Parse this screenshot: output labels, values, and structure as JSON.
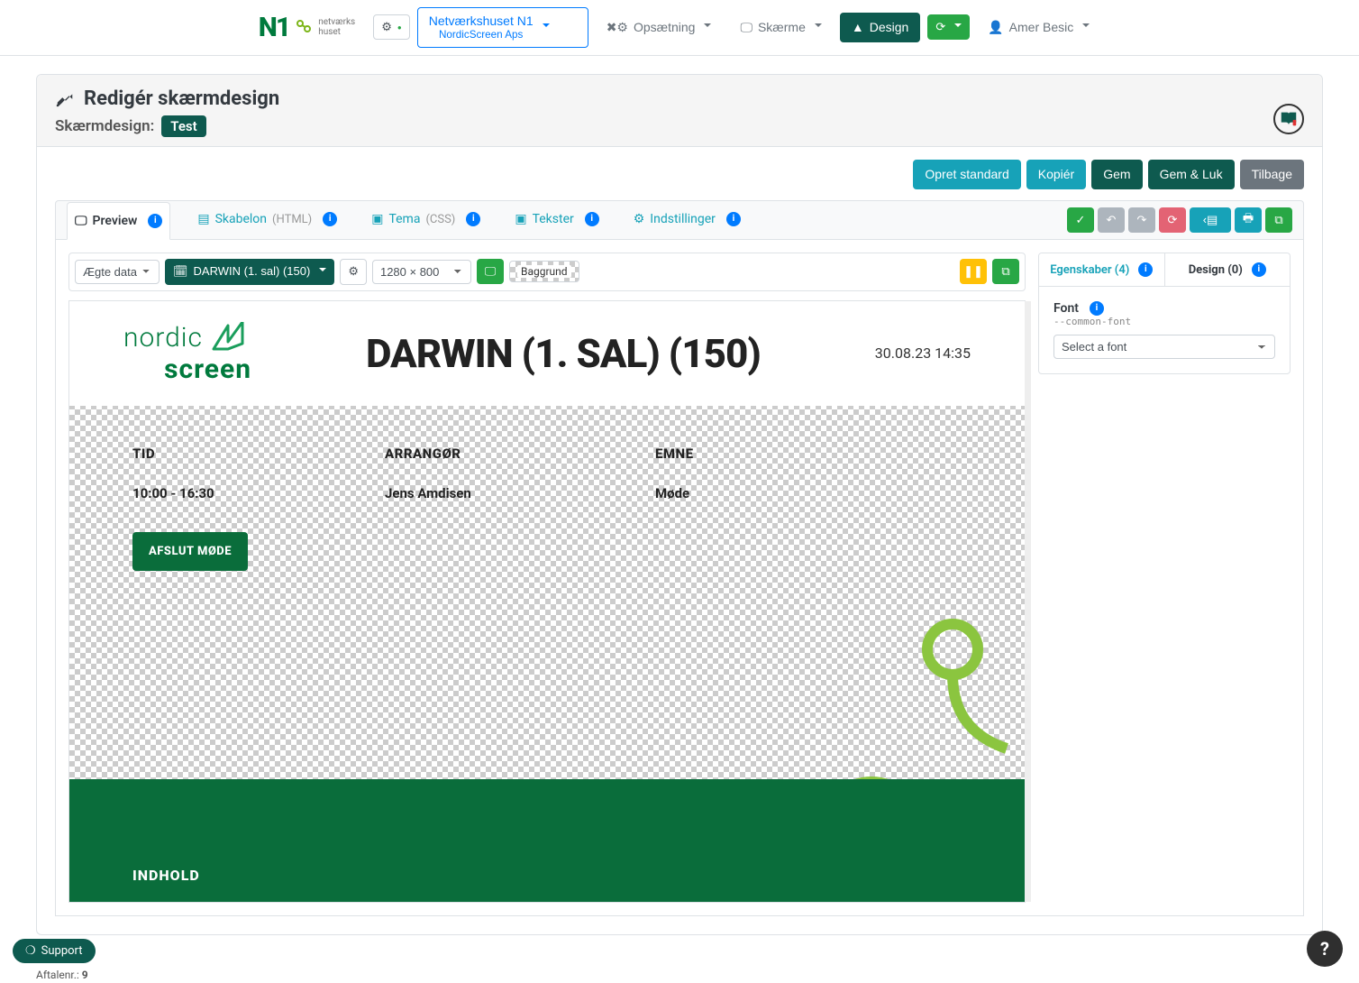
{
  "nav": {
    "logo_text": "netværks\nhuset",
    "org_line1": "Netværkshuset N1",
    "org_line2": "NordicScreen Aps",
    "setup": "Opsætning",
    "screens": "Skærme",
    "design": "Design",
    "user": "Amer Besic"
  },
  "page": {
    "title": "Redigér skærmdesign",
    "subhead_label": "Skærmdesign:",
    "design_name": "Test"
  },
  "actions": {
    "create_standard": "Opret standard",
    "copy": "Kopiér",
    "save": "Gem",
    "save_close": "Gem & Luk",
    "back": "Tilbage"
  },
  "tabs": {
    "preview": "Preview",
    "template": "Skabelon",
    "template_sec": "(HTML)",
    "theme": "Tema",
    "theme_sec": "(CSS)",
    "texts": "Tekster",
    "settings": "Indstillinger"
  },
  "preview_toolbar": {
    "data_source": "Ægte data",
    "room": "DARWIN (1. sal) (150)",
    "resolution": "1280 × 800",
    "background_toggle": "Baggrund"
  },
  "preview": {
    "brand_a": "nordic",
    "brand_b": "screen",
    "title": "DARWIN (1. SAL) (150)",
    "datetime": "30.08.23 14:35",
    "col1_label": "TID",
    "col1_value": "10:00 - 16:30",
    "col2_label": "ARRANGØR",
    "col2_value": "Jens Amdisen",
    "col3_label": "EMNE",
    "col3_value": "Møde",
    "end_button": "AFSLUT MØDE",
    "footer_label": "INDHOLD"
  },
  "side": {
    "tab_props": "Egenskaber (4)",
    "tab_design": "Design (0)",
    "font_label": "Font",
    "font_hint": "--common-font",
    "font_placeholder": "Select a font"
  },
  "support": "Support",
  "footer_meta_label": "Aftalenr.:",
  "footer_meta_value": "9"
}
